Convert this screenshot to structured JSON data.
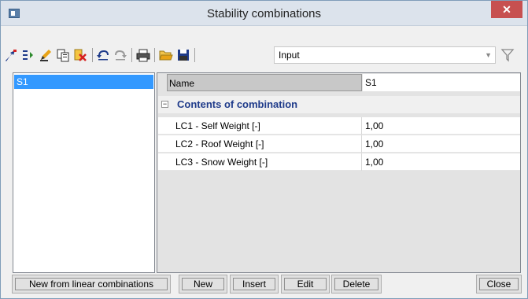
{
  "window": {
    "title": "Stability combinations"
  },
  "toolbar": {
    "combo_value": "Input",
    "icons": [
      "new-from-icon",
      "insert-icon",
      "edit-icon",
      "copy-icon",
      "delete-icon",
      "undo-icon",
      "redo-icon",
      "print-icon",
      "open-icon",
      "save-icon"
    ]
  },
  "list": {
    "items": [
      {
        "label": "S1"
      }
    ]
  },
  "properties": {
    "name_label": "Name",
    "name_value": "S1",
    "group_label": "Contents of combination",
    "rows": [
      {
        "label": "LC1 - Self Weight [-]",
        "value": "1,00"
      },
      {
        "label": "LC2 - Roof Weight [-]",
        "value": "1,00"
      },
      {
        "label": "LC3 - Snow Weight [-]",
        "value": "1,00"
      }
    ]
  },
  "buttons": {
    "new_from_linear": "New from linear combinations",
    "new": "New",
    "insert": "Insert",
    "edit": "Edit",
    "delete": "Delete",
    "close": "Close"
  },
  "colors": {
    "selection": "#3399ff",
    "group_text": "#1f3b8a",
    "close_button": "#c75050"
  }
}
